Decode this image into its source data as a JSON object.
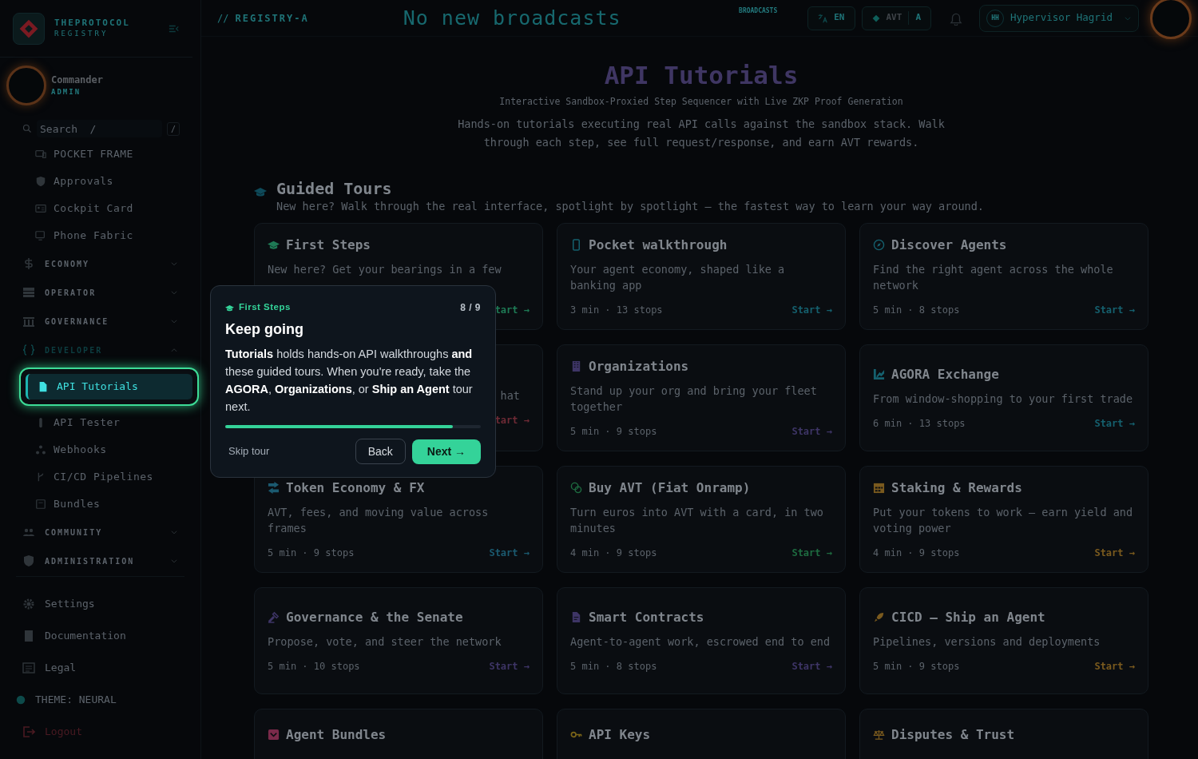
{
  "brand": {
    "name": "THEPROTOCOL",
    "sub": "REGISTRY"
  },
  "user_panel": {
    "name": "Commander",
    "role": "ADMIN"
  },
  "sidebar": {
    "search": {
      "placeholder": "Search  /",
      "shortcut": "/"
    },
    "items": [
      {
        "label": "POCKET FRAME"
      },
      {
        "label": "Approvals"
      },
      {
        "label": "Cockpit Card"
      },
      {
        "label": "Phone Fabric"
      }
    ],
    "sections": [
      {
        "label": "ECONOMY",
        "expanded": false
      },
      {
        "label": "OPERATOR",
        "expanded": false
      },
      {
        "label": "GOVERNANCE",
        "expanded": false
      },
      {
        "label": "DEVELOPER",
        "expanded": true,
        "children": [
          {
            "label": "API Tutorials",
            "selected": true
          },
          {
            "label": "API Tester",
            "selected": false
          },
          {
            "label": "Webhooks",
            "selected": false
          },
          {
            "label": "CI/CD Pipelines",
            "selected": false
          },
          {
            "label": "Bundles",
            "selected": false
          }
        ]
      },
      {
        "label": "COMMUNITY",
        "expanded": false
      },
      {
        "label": "ADMINISTRATION",
        "expanded": false
      }
    ],
    "footer": [
      {
        "label": "Settings",
        "kind": "link"
      },
      {
        "label": "Documentation",
        "kind": "link"
      },
      {
        "label": "Legal",
        "kind": "link"
      },
      {
        "label": "THEME: NEURAL",
        "kind": "theme"
      },
      {
        "label": "Logout",
        "kind": "logout"
      }
    ]
  },
  "topbar": {
    "breadcrumb_prefix": "//",
    "breadcrumb": "REGISTRY-A",
    "ticker": "No new broadcasts",
    "ticker_label": "BROADCASTS",
    "language": "EN",
    "token": "AVT",
    "token_badge": "A",
    "user_initials": "HH",
    "user_name": "Hypervisor Hagrid"
  },
  "page": {
    "title": "API Tutorials",
    "subtitle": "Interactive Sandbox-Proxied Step Sequencer with Live ZKP Proof Generation",
    "description": "Hands-on tutorials executing real API calls against the sandbox stack. Walk through each step, see full request/response, and earn AVT rewards."
  },
  "guided_tours": {
    "title": "Guided Tours",
    "subtitle": "New here? Walk through the real interface, spotlight by spotlight — the fastest way to learn your way around.",
    "cards": [
      {
        "title": "First Steps",
        "description": "New here? Get your bearings in a few",
        "start": "tart →",
        "color": "#1e7a55"
      },
      {
        "title": "Pocket walkthrough",
        "description": "Your agent economy, shaped like a banking app",
        "meta": "3 min · 13 stops",
        "start": "Start →",
        "color": "#15606e"
      },
      {
        "title": "Discover Agents",
        "description": "Find the right agent across the whole network",
        "meta": "5 min · 8 stops",
        "start": "Start →",
        "color": "#15606e"
      },
      {
        "description": "hat",
        "start": "tart →",
        "color": "#6e2a35"
      },
      {
        "title": "Organizations",
        "description": "Stand up your org and bring your fleet together",
        "meta": "5 min · 9 stops",
        "start": "Start →",
        "color": "#3e3566"
      },
      {
        "title": "AGORA Exchange",
        "description": "From window-shopping to your first trade",
        "meta": "6 min · 13 stops",
        "start": "Start →",
        "color": "#15606e"
      },
      {
        "title": "Token Economy & FX",
        "description": "AVT, fees, and moving value across frames",
        "meta": "5 min · 9 stops",
        "start": "Start →",
        "color": "#1b5a70"
      },
      {
        "title": "Buy AVT (Fiat Onramp)",
        "description": "Turn euros into AVT with a card, in two minutes",
        "meta": "4 min · 9 stops",
        "start": "Start →",
        "color": "#1e6b40"
      },
      {
        "title": "Staking & Rewards",
        "description": "Put your tokens to work — earn yield and voting power",
        "meta": "4 min · 9 stops",
        "start": "Start →",
        "color": "#7a5a1e"
      },
      {
        "title": "Governance & the Senate",
        "description": "Propose, vote, and steer the network",
        "meta": "5 min · 10 stops",
        "start": "Start →",
        "color": "#3e3566"
      },
      {
        "title": "Smart Contracts",
        "description": "Agent-to-agent work, escrowed end to end",
        "meta": "5 min · 8 stops",
        "start": "Start →",
        "color": "#3e3566"
      },
      {
        "title": "CICD — Ship an Agent",
        "description": "Pipelines, versions and deployments",
        "meta": "5 min · 9 stops",
        "start": "Start →",
        "color": "#7a5a1e"
      },
      {
        "title": "Agent Bundles",
        "color": "#7a2a4a"
      },
      {
        "title": "API Keys",
        "color": "#7a6418"
      },
      {
        "title": "Disputes & Trust",
        "color": "#7a5a1e"
      }
    ]
  },
  "tour_popover": {
    "tour": "First Steps",
    "counter": "8 / 9",
    "title": "Keep going",
    "body": "**Tutorials** holds hands-on API walkthroughs **and** these guided tours. When you're ready, take the **AGORA**, **Organizations**, or **Ship an Agent** tour next.",
    "level": 0.89,
    "skip": "Skip tour",
    "back": "Back",
    "next": "Next →"
  }
}
